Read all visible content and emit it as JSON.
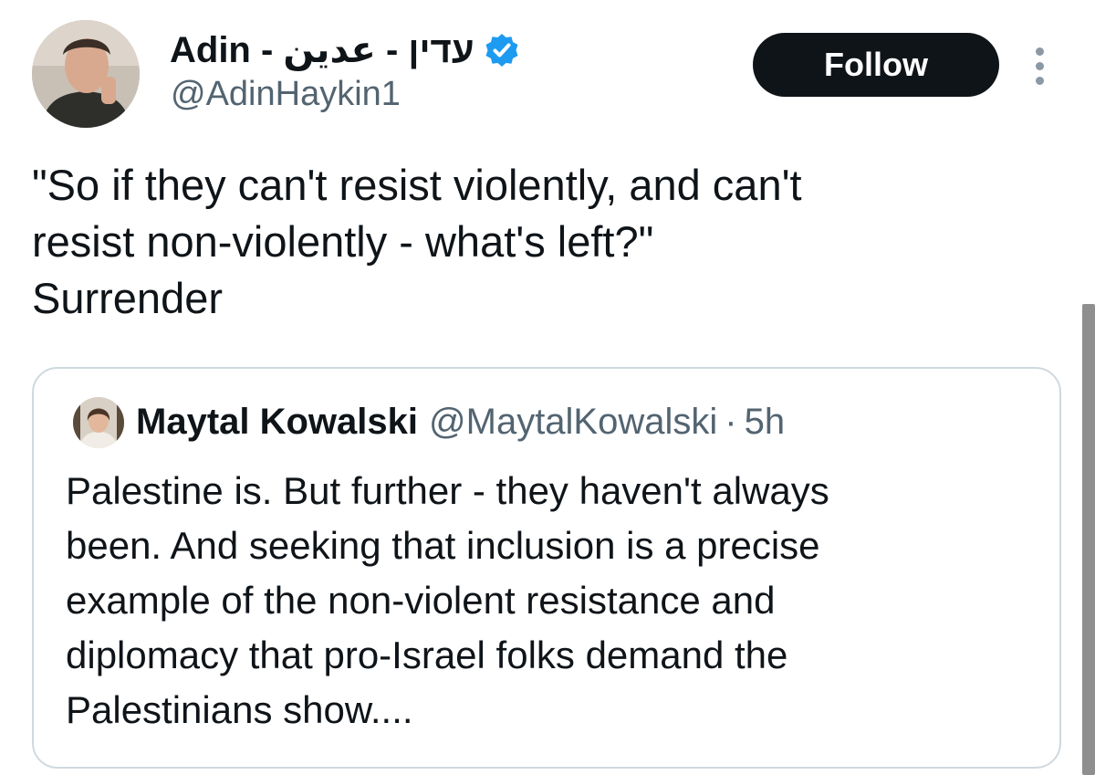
{
  "author": {
    "display_name": "Adin - עדין - عدين",
    "handle": "@AdinHaykin1",
    "verified_icon": "verified-badge-icon",
    "avatar_icon": "user-photo-avatar"
  },
  "actions": {
    "follow_label": "Follow",
    "more_icon": "more-options-icon"
  },
  "tweet": {
    "lines": [
      "\"So if they can't resist violently, and can't",
      "resist non-violently - what's left?\"",
      "Surrender"
    ]
  },
  "quote": {
    "display_name": "Maytal Kowalski",
    "handle": "@MaytalKowalski",
    "separator": "·",
    "time": "5h",
    "lines": [
      "Palestine is. But further - they haven't always",
      "been. And seeking that inclusion is a precise",
      "example of the non-violent resistance and",
      "diplomacy that pro-Israel folks demand the",
      "Palestinians show...."
    ]
  },
  "colors": {
    "accent": "#1d9bf0",
    "text_primary": "#0f1419",
    "text_secondary": "#536471",
    "follow_bg": "#0f1419",
    "border": "#cfd9de"
  }
}
